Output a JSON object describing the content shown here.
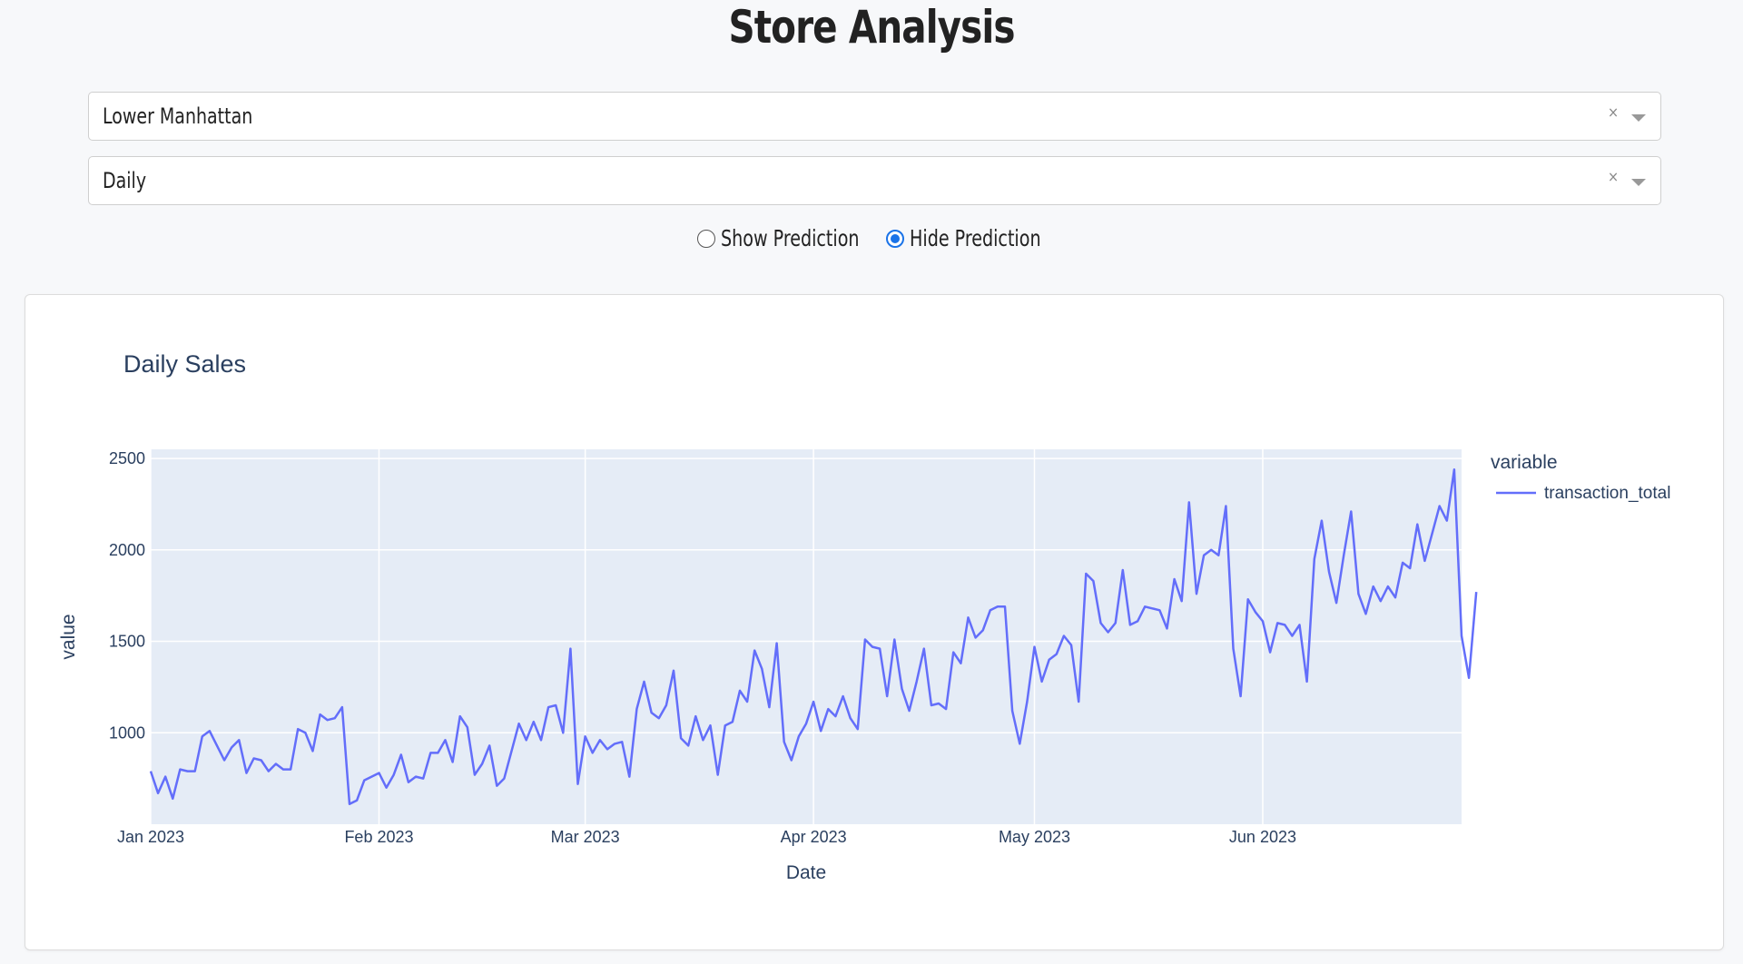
{
  "page": {
    "title": "Store Analysis"
  },
  "filters": {
    "store": {
      "value": "Lower Manhattan",
      "clear": "×"
    },
    "period": {
      "value": "Daily",
      "clear": "×"
    }
  },
  "prediction_toggle": {
    "options": [
      {
        "label": "Show Prediction",
        "checked": false
      },
      {
        "label": "Hide Prediction",
        "checked": true
      }
    ]
  },
  "chart_data": {
    "type": "line",
    "title": "Daily Sales",
    "xlabel": "Date",
    "ylabel": "value",
    "legend_title": "variable",
    "legend_position": "top-right",
    "grid": true,
    "ylim": [
      500,
      2550
    ],
    "y_ticks": [
      1000,
      1500,
      2000,
      2500
    ],
    "x_ticks": [
      {
        "date": "2023-01-01",
        "label": "Jan 2023"
      },
      {
        "date": "2023-02-01",
        "label": "Feb 2023"
      },
      {
        "date": "2023-03-01",
        "label": "Mar 2023"
      },
      {
        "date": "2023-04-01",
        "label": "Apr 2023"
      },
      {
        "date": "2023-05-01",
        "label": "May 2023"
      },
      {
        "date": "2023-06-01",
        "label": "Jun 2023"
      }
    ],
    "x_range": [
      "2023-01-01",
      "2023-06-28"
    ],
    "series": [
      {
        "name": "transaction_total",
        "color": "#636efa",
        "x_start": "2023-01-01",
        "x_step": "1 day",
        "values": [
          790,
          670,
          760,
          640,
          800,
          790,
          790,
          980,
          1010,
          930,
          850,
          920,
          960,
          780,
          860,
          850,
          790,
          830,
          800,
          800,
          1020,
          1000,
          900,
          1100,
          1070,
          1080,
          1140,
          610,
          630,
          740,
          760,
          780,
          700,
          770,
          880,
          730,
          760,
          750,
          890,
          890,
          960,
          840,
          1090,
          1030,
          770,
          830,
          930,
          710,
          750,
          900,
          1050,
          960,
          1060,
          960,
          1140,
          1150,
          1000,
          1460,
          720,
          980,
          890,
          960,
          910,
          940,
          950,
          760,
          1130,
          1280,
          1110,
          1080,
          1150,
          1340,
          970,
          930,
          1090,
          960,
          1040,
          770,
          1040,
          1060,
          1230,
          1170,
          1450,
          1350,
          1140,
          1490,
          950,
          850,
          980,
          1050,
          1170,
          1010,
          1130,
          1090,
          1200,
          1080,
          1020,
          1510,
          1470,
          1460,
          1200,
          1510,
          1240,
          1120,
          1280,
          1460,
          1150,
          1160,
          1130,
          1440,
          1380,
          1630,
          1520,
          1560,
          1670,
          1690,
          1690,
          1120,
          940,
          1170,
          1470,
          1280,
          1400,
          1430,
          1530,
          1480,
          1170,
          1870,
          1830,
          1600,
          1550,
          1600,
          1890,
          1590,
          1610,
          1690,
          1680,
          1670,
          1570,
          1840,
          1720,
          2260,
          1760,
          1970,
          2000,
          1970,
          2240,
          1460,
          1200,
          1730,
          1660,
          1610,
          1440,
          1600,
          1590,
          1530,
          1590,
          1280,
          1950,
          2160,
          1880,
          1710,
          1970,
          2210,
          1760,
          1650,
          1800,
          1720,
          1800,
          1740,
          1930,
          1900,
          2140,
          1940,
          2090,
          2240,
          2160,
          2440,
          1530,
          1300,
          1770
        ]
      }
    ]
  }
}
